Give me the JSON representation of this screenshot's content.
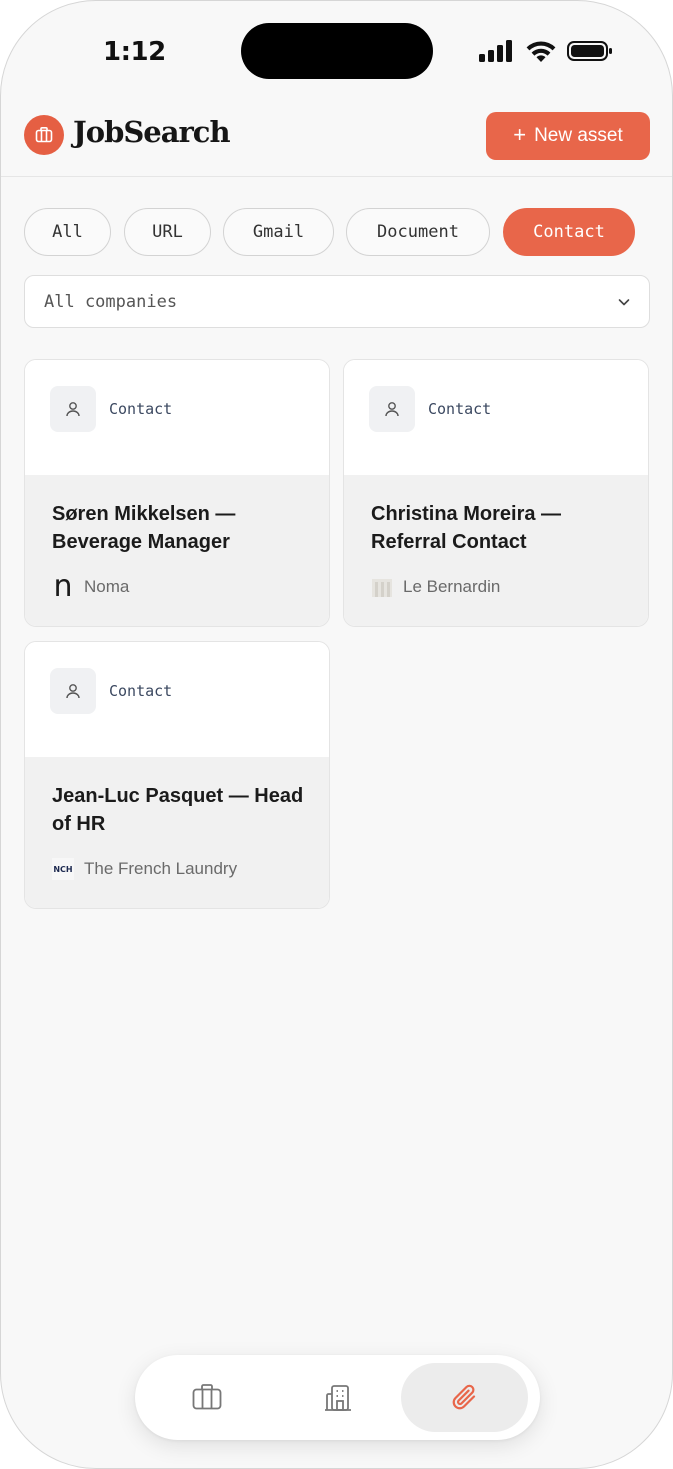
{
  "status_bar": {
    "time": "1:12"
  },
  "header": {
    "app_name": "JobSearch",
    "new_asset_label": "New asset"
  },
  "filters": {
    "chips": [
      {
        "label": "All",
        "active": false
      },
      {
        "label": "URL",
        "active": false
      },
      {
        "label": "Gmail",
        "active": false
      },
      {
        "label": "Document",
        "active": false
      },
      {
        "label": "Contact",
        "active": true
      }
    ]
  },
  "company_filter": {
    "selected": "All companies"
  },
  "cards": [
    {
      "type": "Contact",
      "title": "Søren Mikkelsen — Beverage Manager",
      "company": "Noma",
      "logo_text": "n"
    },
    {
      "type": "Contact",
      "title": "Christina Moreira — Referral Contact",
      "company": "Le Bernardin",
      "logo_text": ""
    },
    {
      "type": "Contact",
      "title": "Jean-Luc Pasquet — Head of HR",
      "company": "The French Laundry",
      "logo_text": "NCH"
    }
  ],
  "bottom_nav": {
    "items": [
      {
        "icon": "briefcase-icon",
        "active": false
      },
      {
        "icon": "building-icon",
        "active": false
      },
      {
        "icon": "paperclip-icon",
        "active": true
      }
    ]
  },
  "colors": {
    "accent": "#e8664a",
    "text": "#1b1b1b",
    "muted": "#6a6a6a"
  }
}
